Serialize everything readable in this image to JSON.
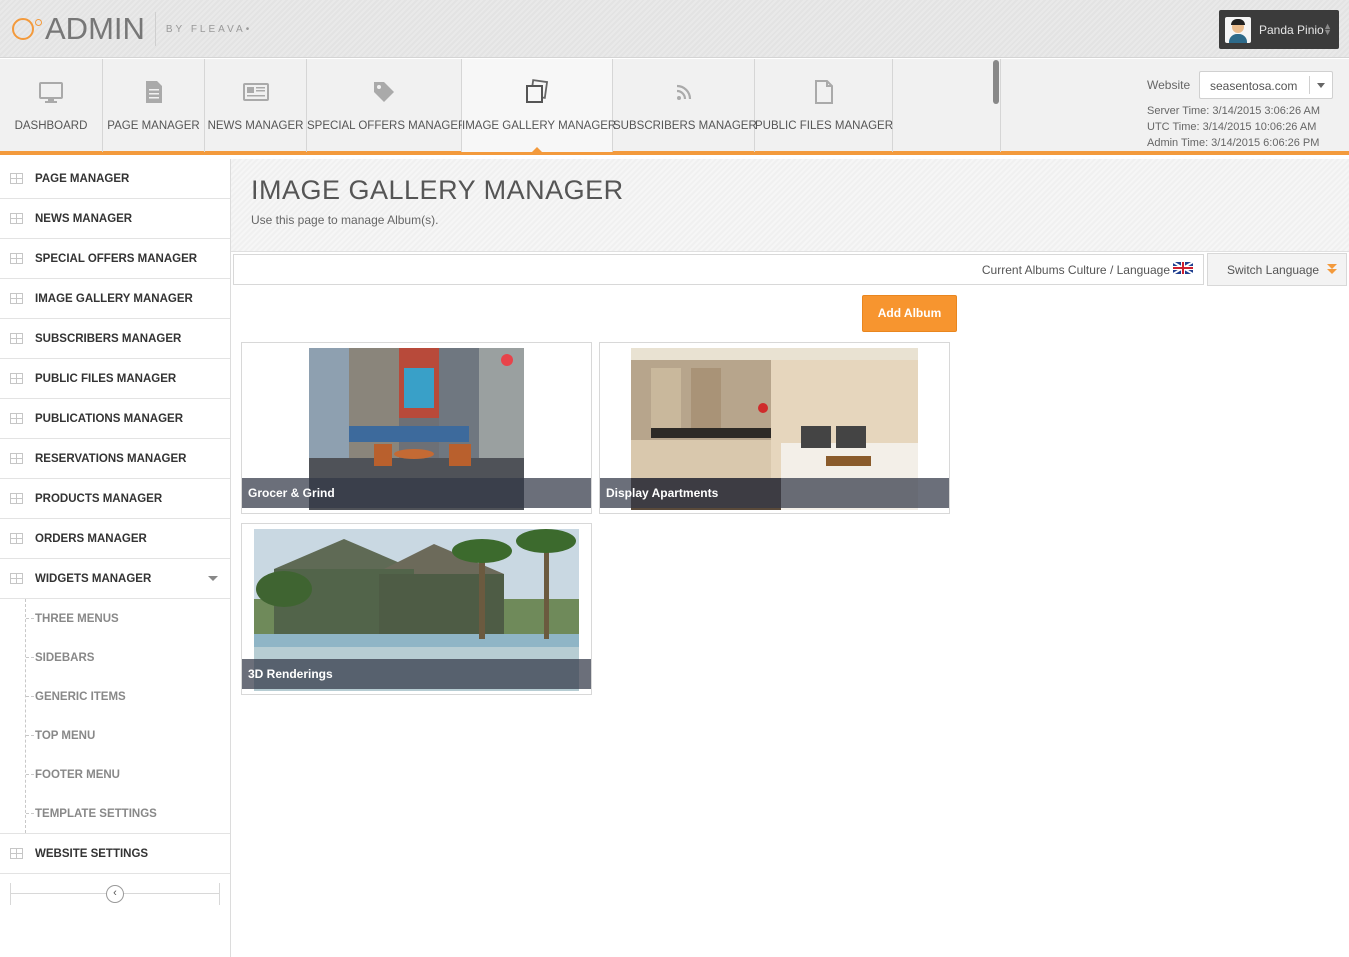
{
  "header": {
    "logo_text": "ADMIN",
    "by_text": "BY FLEAVA•",
    "user_name": "Panda Pinio"
  },
  "topnav": {
    "items": [
      {
        "label": "DASHBOARD",
        "icon": "monitor-icon"
      },
      {
        "label": "PAGE MANAGER",
        "icon": "document-icon"
      },
      {
        "label": "NEWS MANAGER",
        "icon": "newspaper-icon"
      },
      {
        "label": "SPECIAL OFFERS MANAGER",
        "icon": "tag-icon"
      },
      {
        "label": "IMAGE GALLERY MANAGER",
        "icon": "photos-icon",
        "active": true
      },
      {
        "label": "SUBSCRIBERS MANAGER",
        "icon": "rss-icon"
      },
      {
        "label": "PUBLIC FILES MANAGER",
        "icon": "file-icon"
      }
    ],
    "website_label": "Website",
    "website_value": "seasentosa.com",
    "server_time": "Server Time: 3/14/2015 3:06:26 AM",
    "utc_time": "UTC Time: 3/14/2015 10:06:26 AM",
    "admin_time": "Admin Time: 3/14/2015 6:06:26 PM"
  },
  "sidebar": {
    "items": [
      {
        "label": "PAGE MANAGER"
      },
      {
        "label": "NEWS MANAGER"
      },
      {
        "label": "SPECIAL OFFERS MANAGER"
      },
      {
        "label": "IMAGE GALLERY MANAGER"
      },
      {
        "label": "SUBSCRIBERS MANAGER"
      },
      {
        "label": "PUBLIC FILES MANAGER"
      },
      {
        "label": "PUBLICATIONS MANAGER"
      },
      {
        "label": "RESERVATIONS MANAGER"
      },
      {
        "label": "PRODUCTS MANAGER"
      },
      {
        "label": "ORDERS MANAGER"
      },
      {
        "label": "WIDGETS MANAGER"
      }
    ],
    "widgets_sub": [
      {
        "label": "THREE MENUS"
      },
      {
        "label": "SIDEBARS"
      },
      {
        "label": "GENERIC ITEMS"
      },
      {
        "label": "TOP MENU"
      },
      {
        "label": "FOOTER MENU"
      },
      {
        "label": "TEMPLATE SETTINGS"
      }
    ],
    "website_settings": "WEBSITE SETTINGS"
  },
  "main": {
    "title": "IMAGE GALLERY MANAGER",
    "subtitle": "Use this page to manage Album(s).",
    "culture_label": "Current Albums Culture / Language",
    "switch_language": "Switch Language",
    "add_album": "Add Album",
    "albums": [
      {
        "caption": "Grocer & Grind"
      },
      {
        "caption": "Display Apartments"
      },
      {
        "caption": "3D Renderings"
      }
    ]
  },
  "colors": {
    "accent": "#f39a3c",
    "button": "#f7952f",
    "dark": "#3b3b3b"
  }
}
